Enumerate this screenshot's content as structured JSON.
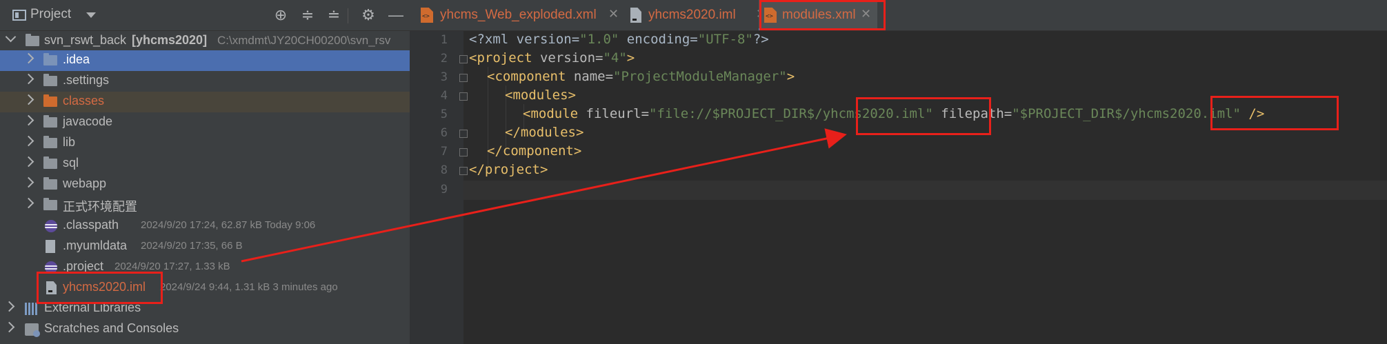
{
  "project_panel": {
    "title": "Project",
    "toolbar_icons": [
      "locate-icon",
      "expand-all-icon",
      "collapse-all-icon",
      "gear-icon",
      "minimize-icon"
    ],
    "root": {
      "name": "svn_rswt_back",
      "module": "[yhcms2020]",
      "path": "C:\\xmdmt\\JY20CH00200\\svn_rsv"
    },
    "items": [
      {
        "label": ".idea"
      },
      {
        "label": ".settings"
      },
      {
        "label": "classes"
      },
      {
        "label": "javacode"
      },
      {
        "label": "lib"
      },
      {
        "label": "sql"
      },
      {
        "label": "webapp"
      },
      {
        "label": "正式环境配置"
      },
      {
        "label": ".classpath",
        "meta": "2024/9/20 17:24, 62.87 kB Today 9:06"
      },
      {
        "label": ".myumldata",
        "meta": "2024/9/20 17:35, 66 B"
      },
      {
        "label": ".project",
        "meta": "2024/9/20 17:27, 1.33 kB"
      },
      {
        "label": "yhcms2020.iml",
        "meta": "2024/9/24 9:44, 1.31 kB 3 minutes ago"
      },
      {
        "label": "External Libraries"
      },
      {
        "label": "Scratches and Consoles"
      }
    ]
  },
  "tabs": [
    {
      "label": "yhcms_Web_exploded.xml",
      "close": "✕"
    },
    {
      "label": "yhcms2020.iml",
      "close": "✕"
    },
    {
      "label": "modules.xml",
      "close": "✕"
    }
  ],
  "editor": {
    "line_numbers": [
      "1",
      "2",
      "3",
      "4",
      "5",
      "6",
      "7",
      "8",
      "9"
    ],
    "lines": {
      "l1": {
        "a": "<?xml version=",
        "b": "\"1.0\"",
        "c": " encoding=",
        "d": "\"UTF-8\"",
        "e": "?>"
      },
      "l2": {
        "a": "<project ",
        "b": "version=",
        "c": "\"4\"",
        "d": ">"
      },
      "l3": {
        "a": "<component ",
        "b": "name=",
        "c": "\"ProjectModuleManager\"",
        "d": ">"
      },
      "l4": {
        "a": "<modules>"
      },
      "l5": {
        "a": "<module ",
        "b": "fileurl=",
        "c": "\"file://$PROJECT_DIR$/yhcms2020.iml\"",
        "d": " filepath=",
        "e": "\"$PROJECT_DIR$/yhcms2020.iml\"",
        "f": " />"
      },
      "l6": {
        "a": "</modules>"
      },
      "l7": {
        "a": "</component>"
      },
      "l8": {
        "a": "</project>"
      }
    }
  },
  "colors": {
    "highlight": "#e8201a",
    "selected_row": "#4b6eaf",
    "module_name": "#cf6b2e"
  }
}
